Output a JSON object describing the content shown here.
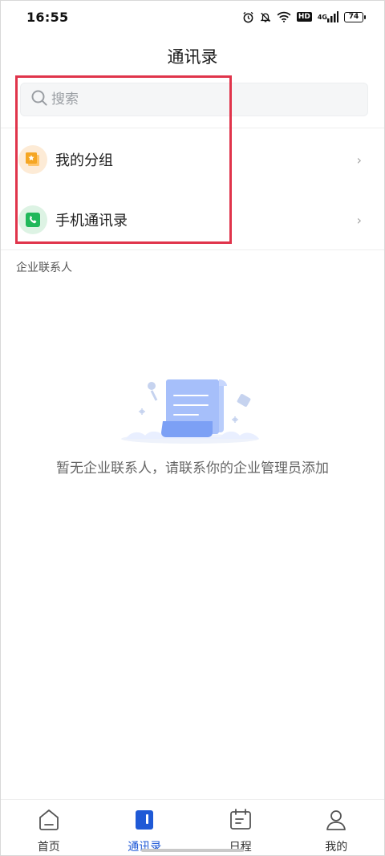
{
  "status": {
    "time": "16:55",
    "hd": "HD",
    "network": "4G",
    "battery": "74"
  },
  "header": {
    "title": "通讯录"
  },
  "search": {
    "placeholder": "搜索"
  },
  "list": [
    {
      "label": "我的分组",
      "icon": "star-folder-icon"
    },
    {
      "label": "手机通讯录",
      "icon": "phone-icon"
    }
  ],
  "section": {
    "title": "企业联系人"
  },
  "empty": {
    "message": "暂无企业联系人，请联系你的企业管理员添加"
  },
  "nav": [
    {
      "label": "首页",
      "icon": "home-icon"
    },
    {
      "label": "通讯录",
      "icon": "contacts-icon",
      "active": true
    },
    {
      "label": "日程",
      "icon": "calendar-icon"
    },
    {
      "label": "我的",
      "icon": "profile-icon"
    }
  ],
  "colors": {
    "accent": "#1f59d6",
    "highlight": "#e0344b",
    "group_icon": "#f5a623",
    "phone_icon": "#21b85b"
  }
}
